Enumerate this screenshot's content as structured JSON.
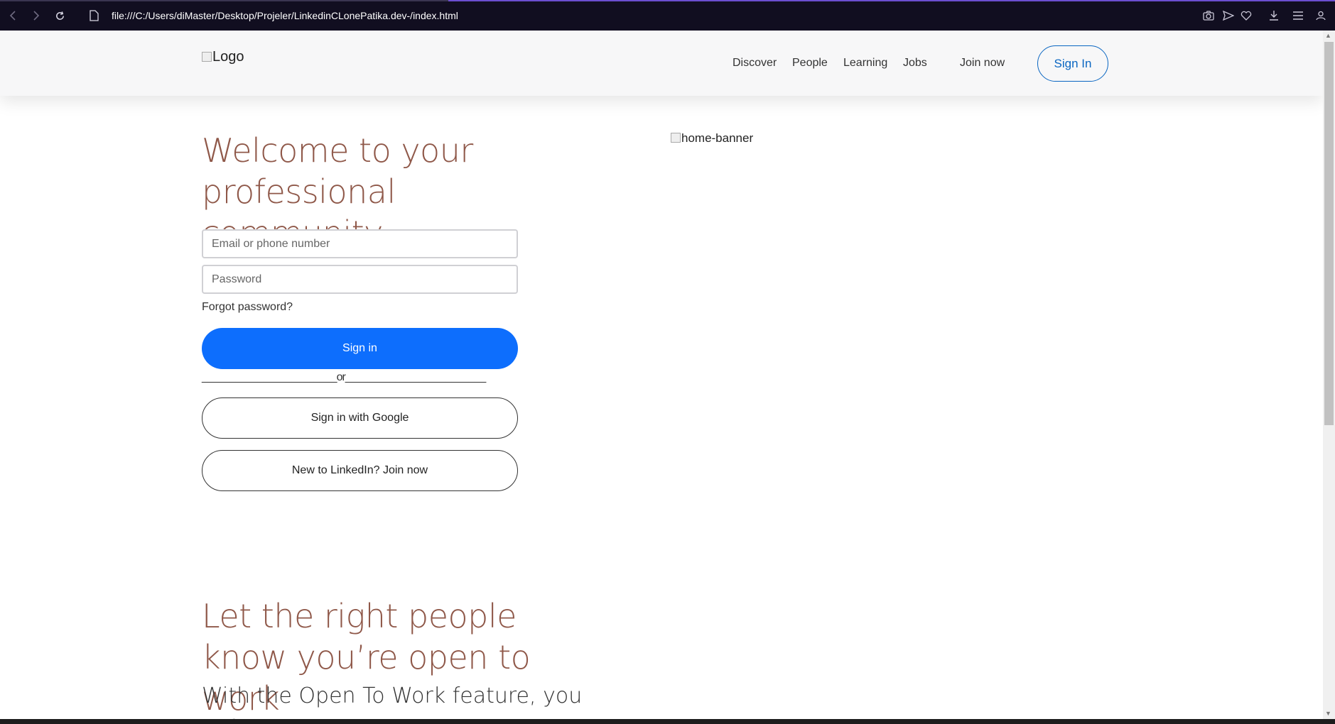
{
  "browser": {
    "url": "file:///C:/Users/diMaster/Desktop/Projeler/LinkedinCLonePatika.dev-/index.html",
    "icons": [
      "back-icon",
      "forward-icon",
      "reload-icon",
      "page-icon",
      "camera-icon",
      "send-icon",
      "heart-icon",
      "download-icon",
      "menu-icon",
      "profile-icon"
    ]
  },
  "header": {
    "logo_alt": "Logo",
    "nav": [
      "Discover",
      "People",
      "Learning",
      "Jobs",
      "Join now"
    ],
    "sign_in": "Sign In"
  },
  "hero": {
    "title": "Welcome to your professional community.",
    "banner_alt": "home-banner"
  },
  "form": {
    "email_placeholder": "Email or phone number",
    "password_placeholder": "Password",
    "forgot": "Forgot password?",
    "sign_in_button": "Sign in",
    "or_divider": "________________________or_________________________",
    "google_button": "Sign in with Google",
    "join_button": "New to LinkedIn? Join now"
  },
  "section2": {
    "title": "Let the right people know you’re open to work",
    "subtitle": "With the Open To Work feature, you can"
  },
  "colors": {
    "heading": "#8f5849",
    "primary": "#0d6efd",
    "link_blue": "#0a66c2",
    "browser_bar": "#110e20"
  }
}
